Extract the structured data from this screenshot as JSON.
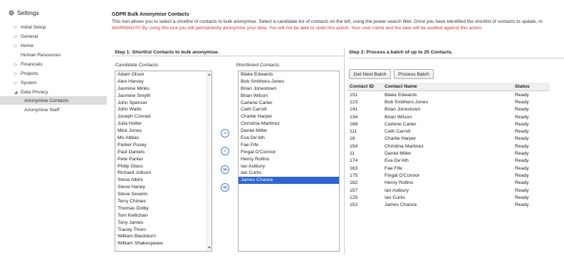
{
  "sidebar": {
    "title": "Settings",
    "items": [
      {
        "label": "Initial Setup",
        "arrow": "▷"
      },
      {
        "label": "General",
        "arrow": "▷"
      },
      {
        "label": "Home",
        "arrow": "▷"
      },
      {
        "label": "Human Resources",
        "arrow": ""
      },
      {
        "label": "Financials",
        "arrow": "▷"
      },
      {
        "label": "Projects",
        "arrow": "▷"
      },
      {
        "label": "System",
        "arrow": "▷"
      },
      {
        "label": "Data Privacy",
        "arrow": "◢"
      },
      {
        "label": "Anonymise Contacts",
        "arrow": ""
      },
      {
        "label": "Anonymise Staff",
        "arrow": ""
      }
    ]
  },
  "page": {
    "title": "GDPR Bulk Anonymise Contacts",
    "intro": "This tool allows you to select a shortlist of contacts to bulk anonymise. Select a candidate list of contacts on the left, using the power search filter. Once you have identified the shortlist of contacts to update, m",
    "warning": "WARNING!!!!! By using this tool you will permanently anonymise your data. You will not be able to undo this action. Your user name and the date will be audited against this action."
  },
  "step1": {
    "heading": "Step 1: Shortlist Contacts to bulk anonymise.",
    "candidate_label": "Candidate Contacts:",
    "shortlist_label": "Shortlisted Contacts:",
    "candidates": [
      "Adam Olson",
      "Alex Harvey",
      "Jasmine Minks",
      "Jasmine Smyth",
      "John Spencer",
      "John Watts",
      "Joseph Conrad",
      "Julia Holter",
      "Mick Jones",
      "Mo Abbas",
      "Parker Posey",
      "Paul Daniels",
      "Pete Parker",
      "Philip Glass",
      "Richard Jobson",
      "Steve Albini",
      "Steve Harley",
      "Steve Severin",
      "Terry Chimes",
      "Thomas Dolby",
      "Tom Kellichan",
      "Tony James",
      "Tracey Thorn",
      "William Blackburn",
      "William Shakespeare"
    ],
    "shortlisted": [
      "Blake Edwards",
      "Bob Smithers-Jones",
      "Brian Jonestown",
      "Brian Wilson",
      "Carlene Carter",
      "Cath Carroll",
      "Charlie Harper",
      "Christina Martinez",
      "Daniel Miller",
      "Eva De'Ath",
      "Fae Fife",
      "Fingal O'Connor",
      "Henry Rollins",
      "Ian Astbury",
      "Ian Curtis",
      "James Chance"
    ],
    "selected_shortlisted": "James Chance",
    "movers": [
      ">",
      "<",
      "≫",
      "≪"
    ]
  },
  "step2": {
    "heading": "Step 2: Process a batch of up to 25 Contacts.",
    "get_next_label": "Get Next Batch",
    "process_label": "Process Batch",
    "columns": [
      "Contact ID",
      "Contact Name",
      "Status"
    ],
    "rows": [
      [
        "151",
        "Blake Edwards",
        "Ready"
      ],
      [
        "123",
        "Bob Smithers-Jones",
        "Ready"
      ],
      [
        "141",
        "Brian Jonestown",
        "Ready"
      ],
      [
        "134",
        "Brian Wilson",
        "Ready"
      ],
      [
        "168",
        "Carlene Carter",
        "Ready"
      ],
      [
        "111",
        "Cath Carroll",
        "Ready"
      ],
      [
        "16",
        "Charlie Harper",
        "Ready"
      ],
      [
        "154",
        "Christina Martinez",
        "Ready"
      ],
      [
        "11",
        "Daniel Miller",
        "Ready"
      ],
      [
        "174",
        "Eva De'Ath",
        "Ready"
      ],
      [
        "163",
        "Fae Fife",
        "Ready"
      ],
      [
        "175",
        "Fingal O'Connor",
        "Ready"
      ],
      [
        "162",
        "Henry Rollins",
        "Ready"
      ],
      [
        "157",
        "Ian Astbury",
        "Ready"
      ],
      [
        "125",
        "Ian Curtis",
        "Ready"
      ],
      [
        "152",
        "James Chance",
        "Ready"
      ]
    ]
  },
  "colors": {
    "accent": "#2e66d1",
    "warning": "#c0392b",
    "active_nav": "#dcdcdc"
  }
}
